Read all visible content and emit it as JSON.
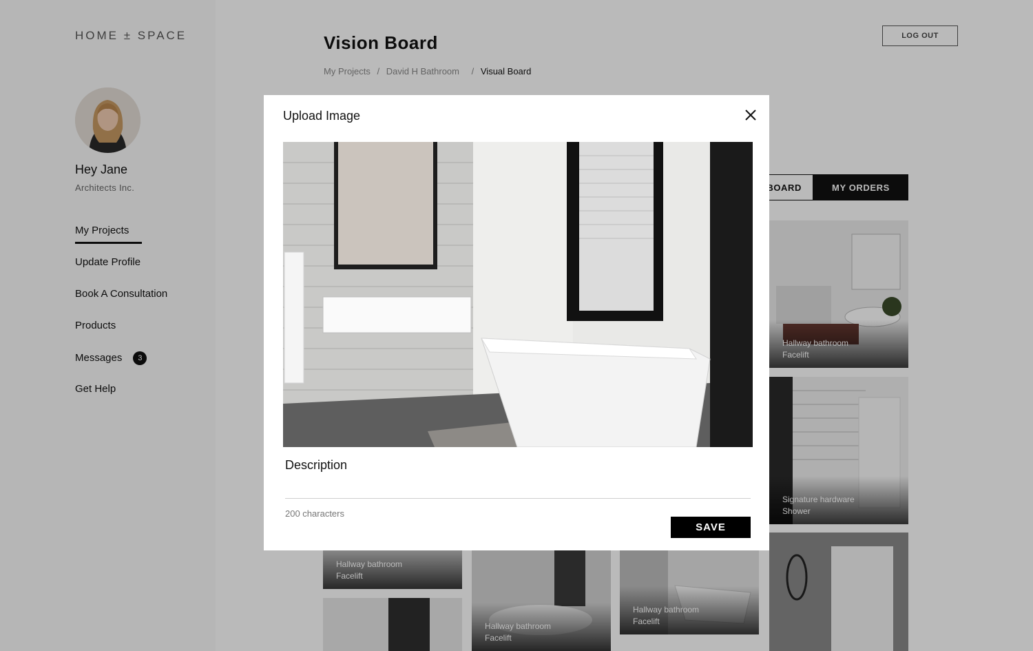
{
  "sidebar": {
    "logo": "HOME ± SPACE",
    "greeting": "Hey Jane",
    "company": "Architects Inc.",
    "nav": [
      {
        "label": "My Projects",
        "active": true
      },
      {
        "label": "Update Profile"
      },
      {
        "label": "Book A Consultation"
      },
      {
        "label": "Products"
      },
      {
        "label": "Messages",
        "badge": "3"
      },
      {
        "label": "Get Help"
      }
    ]
  },
  "header": {
    "title": "Vision Board",
    "logout_label": "LOG OUT",
    "breadcrumb": [
      "My Projects",
      "David H Bathroom",
      "Visual Board"
    ]
  },
  "tabs": {
    "vision_board": "BOARD",
    "my_orders": "MY ORDERS"
  },
  "tiles": [
    {
      "line1": "Hallway bathroom",
      "line2": "Facelift"
    },
    {
      "line1": "Signature hardware",
      "line2": "Shower"
    },
    {
      "line1": "Hallway bathroom",
      "line2": "Facelift"
    },
    {
      "line1": "Hallway bathroom",
      "line2": "Facelift"
    },
    {
      "line1": "Hallway bathroom",
      "line2": "Facelift"
    }
  ],
  "modal": {
    "title": "Upload Image",
    "description_label": "Description",
    "description_value": "",
    "char_limit": "200 characters",
    "save_label": "SAVE"
  }
}
